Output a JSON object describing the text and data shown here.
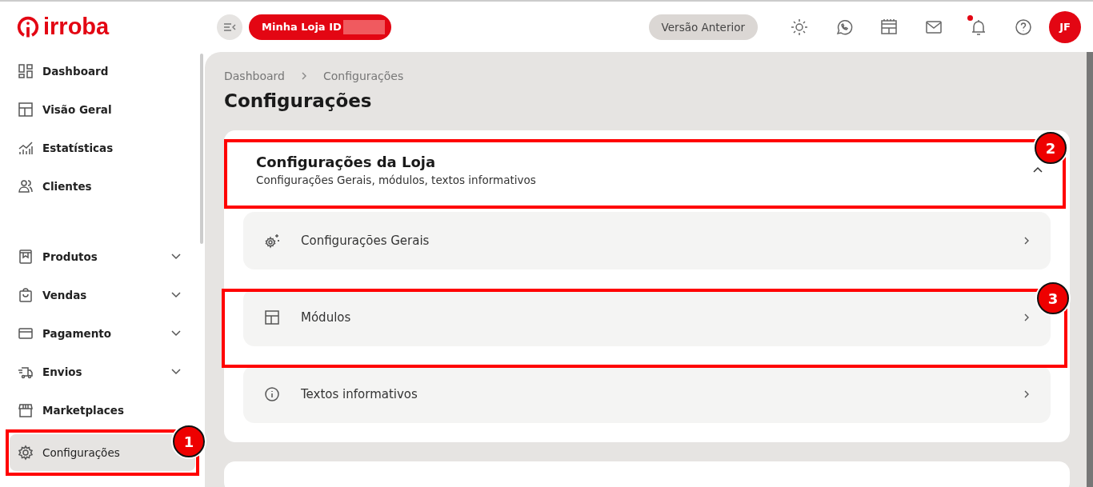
{
  "header": {
    "logo": "irroba",
    "store_button": "Minha Loja ID",
    "legacy_button": "Versão Anterior",
    "notifications_unread": true,
    "avatar": "JF"
  },
  "sidebar": {
    "items": [
      {
        "label": "Dashboard",
        "selected": false,
        "expandable": false
      },
      {
        "label": "Visão Geral",
        "selected": false,
        "expandable": false
      },
      {
        "label": "Estatísticas",
        "selected": false,
        "expandable": false
      },
      {
        "label": "Clientes",
        "selected": false,
        "expandable": false
      },
      {
        "label": "Produtos",
        "selected": false,
        "expandable": true
      },
      {
        "label": "Vendas",
        "selected": false,
        "expandable": true
      },
      {
        "label": "Pagamento",
        "selected": false,
        "expandable": true
      },
      {
        "label": "Envios",
        "selected": false,
        "expandable": true
      },
      {
        "label": "Marketplaces",
        "selected": false,
        "expandable": false
      },
      {
        "label": "Configurações",
        "selected": true,
        "expandable": false
      }
    ]
  },
  "breadcrumb": [
    "Dashboard",
    "Configurações"
  ],
  "page_title": "Configurações",
  "section": {
    "title": "Configurações da Loja",
    "subtitle": "Configurações Gerais, módulos, textos informativos",
    "expanded": true,
    "items": [
      {
        "label": "Configurações Gerais"
      },
      {
        "label": "Módulos"
      },
      {
        "label": "Textos informativos"
      }
    ]
  },
  "annotations": [
    {
      "number": "1"
    },
    {
      "number": "2"
    },
    {
      "number": "3"
    }
  ]
}
